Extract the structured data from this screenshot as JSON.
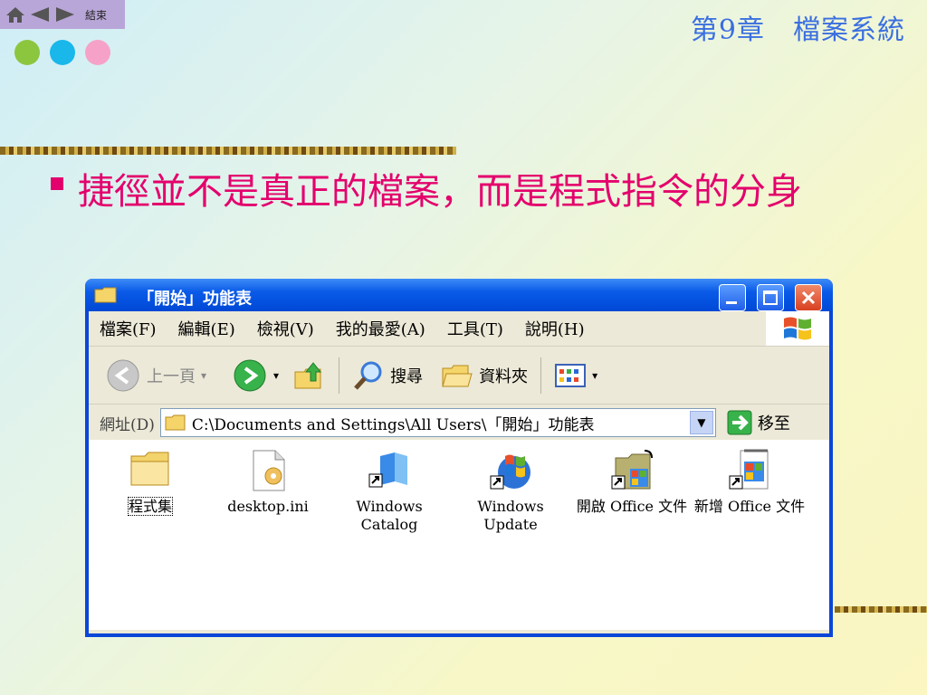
{
  "nav": {
    "end_label": "結束",
    "icons": [
      "home-icon",
      "prev-icon",
      "next-icon"
    ]
  },
  "dots": [
    "#8cc63f",
    "#1ab7ea",
    "#f6a2c8"
  ],
  "chapter": "第9章　檔案系統",
  "heading": "捷徑並不是真正的檔案，而是程式指令的分身",
  "window": {
    "title": "「開始」功能表",
    "menu": [
      "檔案(F)",
      "編輯(E)",
      "檢視(V)",
      "我的最愛(A)",
      "工具(T)",
      "說明(H)"
    ],
    "toolbar": {
      "back": "上一頁",
      "search": "搜尋",
      "folders": "資料夾"
    },
    "address": {
      "label": "網址(D)",
      "value": "C:\\Documents and Settings\\All Users\\「開始」功能表",
      "go": "移至"
    },
    "items": [
      {
        "label": "程式集",
        "icon": "folder-icon"
      },
      {
        "label": "desktop.ini",
        "icon": "ini-file-icon"
      },
      {
        "label": "Windows Catalog",
        "icon": "windows-catalog-icon"
      },
      {
        "label": "Windows Update",
        "icon": "windows-update-icon"
      },
      {
        "label": "開啟 Office 文件",
        "icon": "open-office-doc-icon"
      },
      {
        "label": "新增 Office 文件",
        "icon": "new-office-doc-icon"
      }
    ]
  },
  "colors": {
    "accent_pink": "#e4006c",
    "chapter_blue": "#3a6fe0",
    "xp_blue": "#0a46d8"
  }
}
